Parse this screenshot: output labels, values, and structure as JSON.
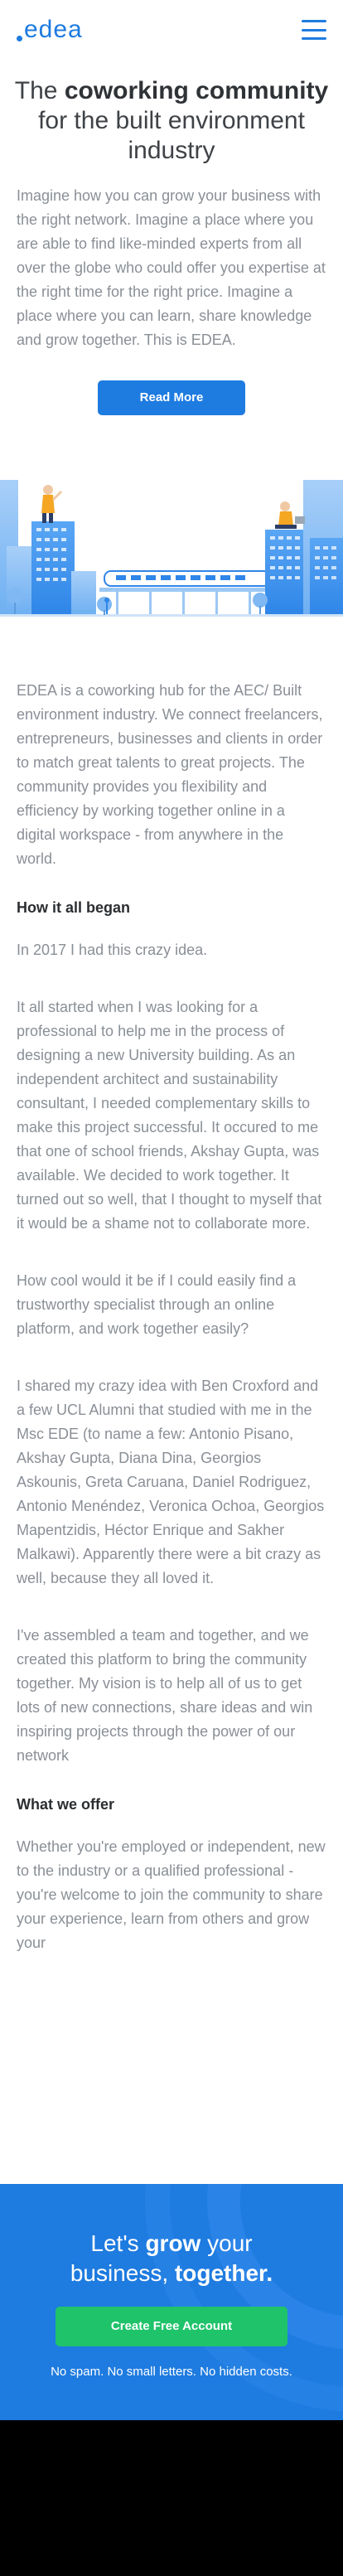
{
  "header": {
    "logo_text": "edea",
    "logo_icon": "edea-logo",
    "menu_icon": "hamburger-menu-icon"
  },
  "hero": {
    "title_pre": "The ",
    "title_bold": "coworking community",
    "title_post": " for the built environment industry",
    "text": "Imagine how you can grow your business with the right network. Imagine a place where you are able to find like-minded experts from all over the globe who could offer you expertise at the right time for the right price. Imagine a place where you can learn, share knowledge and grow together. This is EDEA.",
    "button": "Read More"
  },
  "intro": {
    "text": "EDEA is a coworking hub for the AEC/ Built environment industry. We connect freelancers, entrepreneurs, businesses and clients in order to match great talents to great projects. The community provides you flexibility and efficiency by working together online in a digital workspace - from anywhere in the world."
  },
  "how": {
    "title": "How it all began",
    "p1": "In 2017 I had this crazy idea.",
    "p2": "It all started when I was looking for a professional to help me in the process of designing a new University building. As an independent architect and sustainability consultant, I needed complementary skills to make this project successful. It occured to me that one of school friends, Akshay Gupta, was available. We decided to work together. It turned out so well, that I thought to myself that it would be a shame not to collaborate more.",
    "p3": "How cool would it be if I could easily find a trustworthy specialist through an online platform, and work together easily?",
    "p4": "I shared my crazy idea with Ben Croxford and a few UCL Alumni that studied with me in the Msc EDE (to name a few: Antonio Pisano, Akshay Gupta, Diana Dina, Georgios Askounis, Greta Caruana, Daniel Rodriguez, Antonio Menéndez, Veronica Ochoa, Georgios Mapentzidis, Héctor Enrique and Sakher Malkawi). Apparently there were a bit crazy as well, because they all loved it.",
    "p5": "I've assembled a team and together, and we created this platform to bring the community together. My vision is to help all of us to get lots of new connections, share ideas and win inspiring projects through the power of our network"
  },
  "offer": {
    "title": "What we offer",
    "text": "Whether you're employed or independent, new to the industry or a qualified professional  - you're welcome to join the community to share your experience, learn from others and grow your"
  },
  "cta": {
    "l1_a": "Let's ",
    "l1_b": "grow",
    "l1_c": " your",
    "l2_a": "business, ",
    "l2_b": "together.",
    "button": "Create Free Account",
    "note": "No spam. No small letters. No hidden costs."
  },
  "colors": {
    "brand_blue": "#1e7be0",
    "cta_green": "#1fc36a",
    "text_gray": "#8a8f96",
    "heading_dark": "#2b2e31"
  }
}
